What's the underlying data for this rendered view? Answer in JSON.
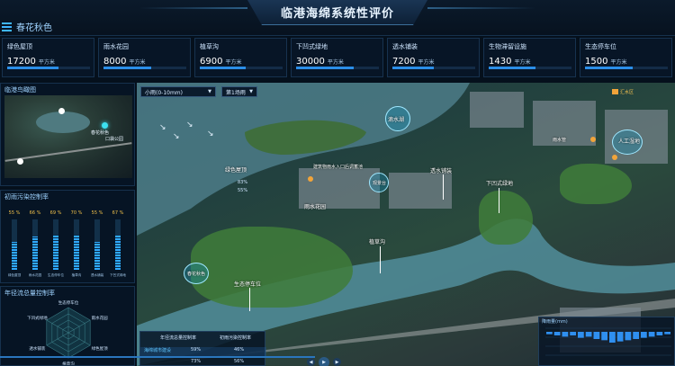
{
  "header": {
    "title": "临港海绵系统性评价",
    "season": "春花秋色"
  },
  "kpis": [
    {
      "name": "绿色屋顶",
      "value": "17200",
      "unit": "平方米",
      "fill": 0.62
    },
    {
      "name": "雨水花园",
      "value": "8000",
      "unit": "平方米",
      "fill": 0.58
    },
    {
      "name": "植草沟",
      "value": "6900",
      "unit": "平方米",
      "fill": 0.55
    },
    {
      "name": "下凹式绿地",
      "value": "30000",
      "unit": "平方米",
      "fill": 0.7
    },
    {
      "name": "透水铺装",
      "value": "7200",
      "unit": "平方米",
      "fill": 0.5
    },
    {
      "name": "生物滞留设施",
      "value": "1430",
      "unit": "平方米",
      "fill": 0.56
    },
    {
      "name": "生态停车位",
      "value": "1500",
      "unit": "平方米",
      "fill": 0.58
    }
  ],
  "left": {
    "map_title": "临港鸟瞰图",
    "map_labels": [
      "春花秋色",
      "口袋公园"
    ],
    "pollution_title": "初雨污染控制率",
    "pollution": [
      {
        "pct": "55 %",
        "value": 55,
        "name": "绿色屋顶"
      },
      {
        "pct": "66 %",
        "value": 66,
        "name": "雨水花园"
      },
      {
        "pct": "69 %",
        "value": 69,
        "name": "生态停车位"
      },
      {
        "pct": "70 %",
        "value": 70,
        "name": "植草沟"
      },
      {
        "pct": "55 %",
        "value": 55,
        "name": "透水铺装"
      },
      {
        "pct": "67 %",
        "value": 67,
        "name": "下凹式绿地"
      }
    ],
    "radar_title": "年径流总量控制率",
    "radar_labels": [
      "生态停车位",
      "雨水花园",
      "绿色屋顶",
      "植草沟",
      "透水铺装",
      "下凹式绿地"
    ]
  },
  "map": {
    "rain_select": "小雨(0-10mm)",
    "scene_select": "第1场雨",
    "labels": {
      "lake": "滴水湖",
      "green_roof": "绿色屋顶",
      "pocket_park": "口袋公园",
      "rain_garden": "雨水花园",
      "grass_swale": "植草沟",
      "ecological_parking": "生态停车位",
      "pervious_paving": "透水铺装",
      "sunken_green": "下凹式绿地",
      "rainwater_pipe": "雨水管",
      "artificial_wetland": "人工湿地",
      "view_point": "观景台",
      "spring_autumn": "春花秋色",
      "building_runoff": "建筑物雨水入口后调蓄池"
    },
    "roof_pcts": [
      "83%",
      "55%"
    ],
    "legend": "汇水区"
  },
  "stats": {
    "headers": [
      "年径流总量控制率",
      "初雨污染控制率"
    ],
    "rows": [
      {
        "label": "海绵城市建设",
        "a": "59%",
        "b": "46%"
      },
      {
        "label": "",
        "a": "73%",
        "b": "56%"
      }
    ]
  },
  "rain_chart": {
    "title": "降雨量(mm)",
    "values": [
      2,
      3,
      4,
      3,
      5,
      4,
      6,
      7,
      9,
      8,
      7,
      6,
      5,
      4,
      3,
      2
    ]
  },
  "colors": {
    "accent": "#2fa9ff",
    "warning": "#f2c14a",
    "bg": "#05101c"
  }
}
